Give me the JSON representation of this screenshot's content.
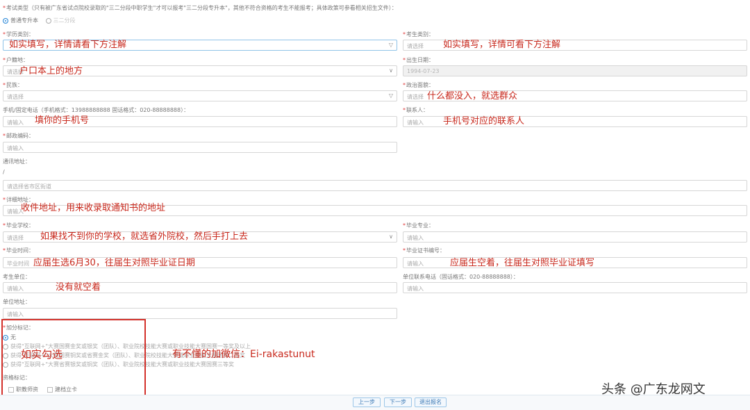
{
  "exam": {
    "label": "考试类型（只有被广东省试点院校录取的\"三二分段中职学生\"才可以报考\"三二分段专升本\"，其他不符合资格的考生不能报考；具体政策可参看相关招生文件）：",
    "option_general": "普通专升本",
    "option_other": "三二分段"
  },
  "fields": {
    "degree_type": {
      "label": "学历类别：",
      "placeholder": "",
      "note": "如实填写，详情请看下方注解"
    },
    "candidate_type": {
      "label": "考生类别：",
      "placeholder": "请选择",
      "note": "如实填写，详情可看下方注解"
    },
    "hukou": {
      "label": "户籍地：",
      "placeholder": "请选择",
      "note": "户口本上的地方"
    },
    "birth_date": {
      "label": "出生日期：",
      "value": "1994-07-23"
    },
    "ethnicity": {
      "label": "民族：",
      "placeholder": "请选择"
    },
    "politics": {
      "label": "政治面貌：",
      "placeholder": "请选择",
      "note": "什么都没入，就选群众"
    },
    "phone": {
      "label": "手机/固定电话（手机格式：13988888888   固话格式：020-88888888）：",
      "placeholder": "请输入",
      "note": "填你的手机号"
    },
    "contact": {
      "label": "联系人：",
      "placeholder": "请输入",
      "note": "手机号对应的联系人"
    },
    "postcode": {
      "label": "邮政编码：",
      "placeholder": "请输入"
    },
    "mail_address": {
      "label": "通讯地址：",
      "slash": "/",
      "placeholder": "请选择省市区街道"
    },
    "detail_address": {
      "label": "详细地址：",
      "placeholder": "请输入",
      "note": "收件地址，用来收录取通知书的地址"
    },
    "school": {
      "label": "毕业学校：",
      "placeholder": "请选择",
      "note": "如果找不到你的学校，就选省外院校，然后手打上去"
    },
    "major": {
      "label": "毕业专业：",
      "placeholder": "请输入"
    },
    "grad_time": {
      "label": "毕业时间：",
      "placeholder": "毕业时间",
      "note": "应届生选6月30，往届生对照毕业证日期"
    },
    "cert_no": {
      "label": "毕业证书编号：",
      "placeholder": "请输入",
      "note": "应届生空着，往届生对照毕业证填写"
    },
    "employer": {
      "label": "考生单位：",
      "placeholder": "请输入",
      "note": "没有就空着"
    },
    "employer_phone": {
      "label": "单位联系电话（固话格式：020-88888888）：",
      "placeholder": "请输入"
    },
    "employer_address": {
      "label": "单位地址：",
      "placeholder": "请输入"
    }
  },
  "bonus": {
    "label": "加分标记：",
    "options": [
      "无",
      "获得\"互联网+\"大赛国赛金奖或银奖（团队）、职业院校技能大赛或职业技能大赛国赛一等奖及以上",
      "获得\"互联网+\"大赛国赛铜奖或省赛金奖（团队）、职业院校技能大赛或职业技能大赛国赛二等奖",
      "获得\"互联网+\"大赛省赛银奖或铜奖（团队）、职业院校技能大赛或职业技能大赛国赛三等奖"
    ],
    "note": "如实勾选"
  },
  "qualification": {
    "label": "资格标记：",
    "options": [
      "职教师资",
      "建档立卡"
    ]
  },
  "wechat_note": "有不懂的加微信：Ei-rakastunut",
  "buttons": {
    "prev": "上一步",
    "next": "下一步",
    "exit": "退出报名"
  },
  "watermark": "头条 @广东龙网文"
}
